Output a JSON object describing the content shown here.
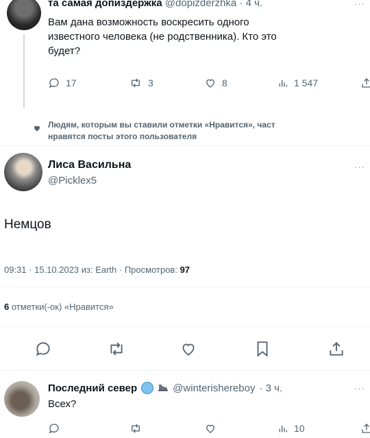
{
  "tweet1": {
    "author_name": "та самая допиздержка",
    "handle": "@dopizderzhka",
    "time": "· 4 ч.",
    "text_lines": [
      "Вам дана возможность воскресить одного",
      "известного человека (не родственника). Кто это",
      "будет?"
    ],
    "replies": "17",
    "retweets": "3",
    "likes": "8",
    "views": "1 547"
  },
  "liked_notice": {
    "line1": "Людям, которым вы ставили отметки «Нравится», част",
    "line2": "нравятся посты этого пользователя"
  },
  "main_tweet": {
    "author_name": "Лиса Васильна",
    "handle": "@Picklex5",
    "text": "Немцов",
    "meta_time": "09:31 · 15.10.2023 из: Earth · Просмотров:",
    "views": "97",
    "likes_count": "6",
    "likes_label": "отметки(-ок) «Нравится»"
  },
  "reply_tweet": {
    "author_name": "Последний север",
    "handle": "@winterishereboy",
    "time": "· 3 ч.",
    "text": "Всех?",
    "views": "10"
  },
  "icons": {
    "reply": "reply-icon",
    "retweet": "retweet-icon",
    "like": "heart-icon",
    "views": "views-icon",
    "share": "share-icon",
    "bookmark": "bookmark-icon",
    "more": "more-icon"
  },
  "colors": {
    "text": "#0f1419",
    "muted": "#536471",
    "divider": "#eff3f4"
  }
}
